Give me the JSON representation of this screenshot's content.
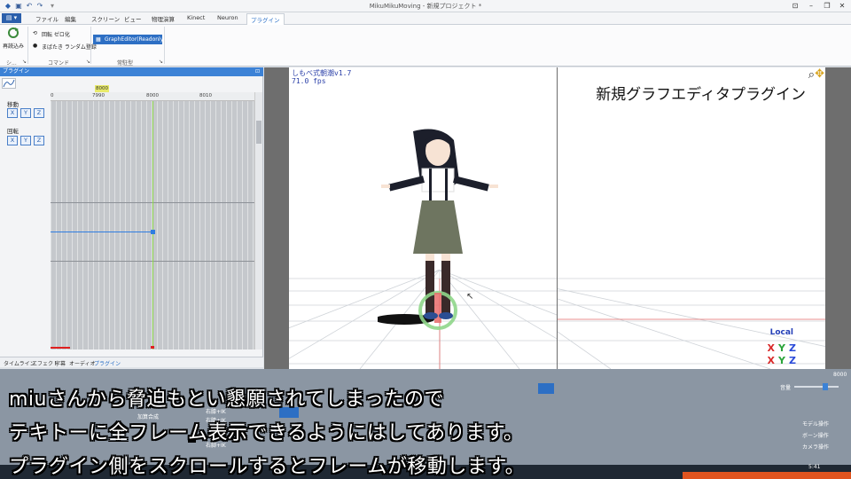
{
  "window": {
    "title": "MikuMikuMoving - 新規プロジェクト *"
  },
  "ribbon": {
    "tabs": [
      {
        "label": "ファイル"
      },
      {
        "label": "編集"
      },
      {
        "label": "スクリーン"
      },
      {
        "label": "ビュー"
      },
      {
        "label": "物理演算"
      },
      {
        "label": "Kinect"
      },
      {
        "label": "Neuron"
      },
      {
        "label": "プラグイン"
      }
    ],
    "reload_label": "再読込み",
    "rotate_zero_label": "回転 ゼロ化",
    "blink_label": "まばたき ランダム登録",
    "graph_editor_label": "GraphEditor(Readonly)",
    "group_system": "シ...",
    "group_command": "コマンド",
    "group_resident": "常駐型"
  },
  "plugin_panel": {
    "title": "プラグイン",
    "move_label": "移動",
    "rotate_label": "回転",
    "axes": [
      "X",
      "Y",
      "Z"
    ],
    "ruler_ticks": [
      "0",
      "7990",
      "8000",
      "8010"
    ],
    "current_frame": "8000",
    "bottom_tabs": [
      "タイムライン",
      "エフェクト",
      "字幕",
      "オーディオ",
      "プラグイン"
    ]
  },
  "viewport": {
    "model_name": "しもべ式朝潮v1.7",
    "fps": "71.0 fps",
    "overlay_title": "新規グラフエディタプラグイン",
    "coord_mode": "Local",
    "axis_letters": [
      "X",
      "Y",
      "Z"
    ]
  },
  "bottom_panel": {
    "volume_label": "音量",
    "frame_value": "8000",
    "add_synth_label": "加算合成",
    "right_knee_ik_1": "右膝+IK",
    "right_knee_ik_2": "右膝+IK",
    "right_foot_ik": "右脚+IK",
    "model_op_label": "モデル操作",
    "bone_op_label": "ボーン操作",
    "camera_op_label": "カメラ操作",
    "clock": "5:41"
  },
  "subtitles": [
    "miuさんから脅迫もとい懇願されてしまったので",
    "テキトーに全フレーム表示できるようにはしてあります。",
    "プラグイン側をスクロールするとフレームが移動します。"
  ],
  "colors": {
    "accent_blue": "#2d6fc4",
    "panel_header": "#3c82d6",
    "playhead_green": "#8bd44a",
    "curve_blue": "#2f7de0"
  }
}
